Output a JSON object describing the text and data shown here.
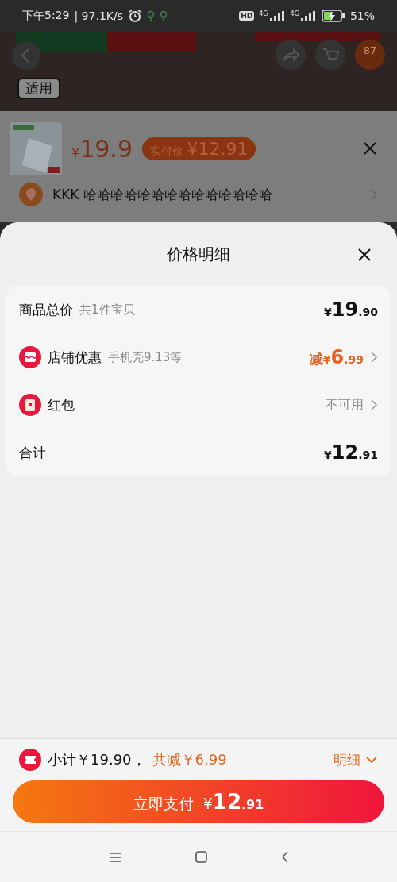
{
  "status_bar": {
    "time": "下午5:29",
    "speed": "| 97.1K/s",
    "hd": "HD",
    "networks": [
      "4G",
      "4G"
    ],
    "battery": "51%",
    "charging": true
  },
  "background_page": {
    "cart_badge": "87",
    "tag": "适用"
  },
  "product_popup": {
    "currency": "¥",
    "price": "19.9",
    "actual_label": "实付价",
    "actual_price": "¥12.91",
    "address": "KKK 哈哈哈哈哈哈哈哈哈哈哈哈哈哈"
  },
  "sheet": {
    "title": "价格明细",
    "rows": [
      {
        "kind": "plain",
        "label": "商品总价",
        "note": "共1件宝贝",
        "currency": "¥",
        "amount": "19",
        "cents": ".90",
        "chevron": false
      },
      {
        "kind": "shop",
        "label": "店铺优惠",
        "note": "手机壳9.13等",
        "prefix": "减",
        "currency": "¥",
        "amount": "6",
        "cents": ".99",
        "chevron": true
      },
      {
        "kind": "redpacket",
        "label": "红包",
        "status": "不可用",
        "chevron": true
      },
      {
        "kind": "plain",
        "label": "合计",
        "currency": "¥",
        "amount": "12",
        "cents": ".91",
        "chevron": false
      }
    ]
  },
  "footer": {
    "subtotal": "小计￥19.90，",
    "discount": "共减￥6.99",
    "details_link": "明细",
    "expanded": false,
    "pay_label": "立即支付",
    "pay_currency": "¥",
    "pay_amount": "12",
    "pay_cents": ".91"
  }
}
